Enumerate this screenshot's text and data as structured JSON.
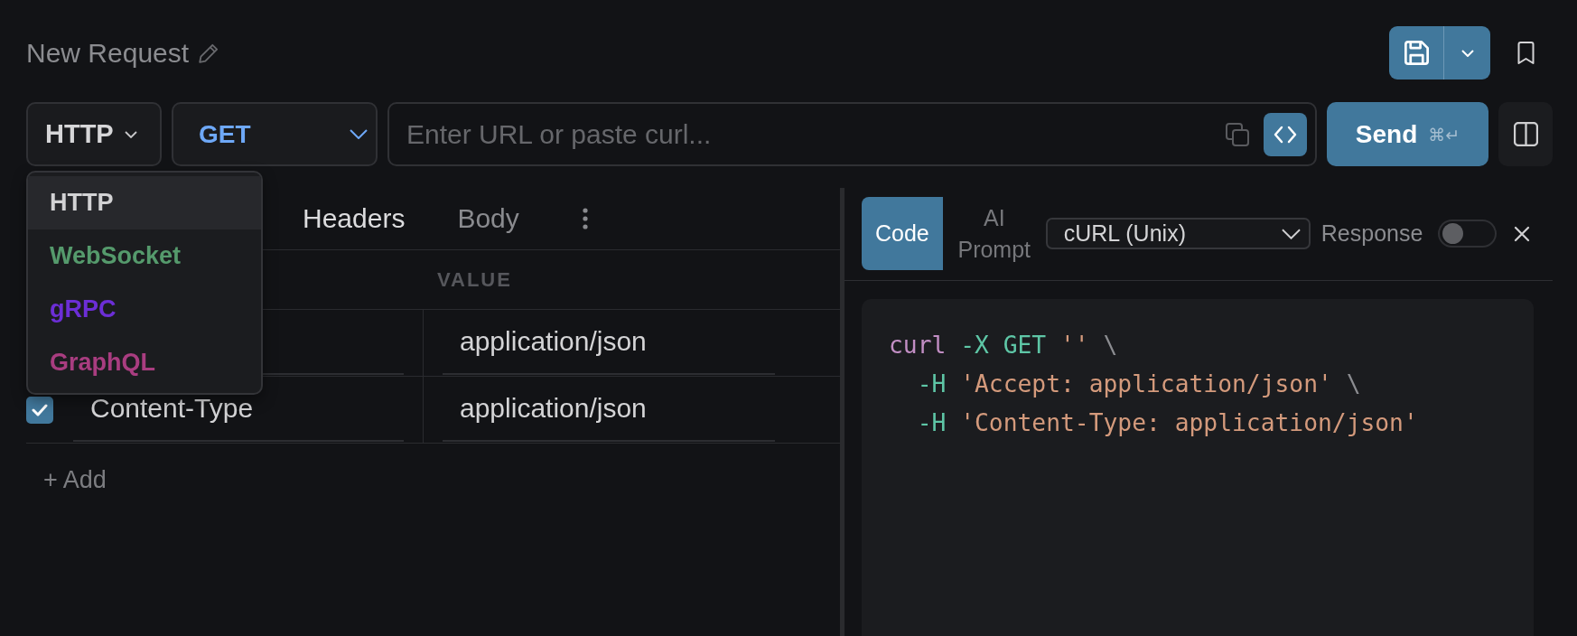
{
  "request": {
    "title": "New Request"
  },
  "toolbar": {
    "protocol": "HTTP",
    "method": "GET",
    "url": {
      "placeholder": "Enter URL or paste curl..."
    },
    "send": {
      "label": "Send",
      "shortcut": "⌘↵"
    }
  },
  "protocol_menu": {
    "items": [
      {
        "label": "HTTP",
        "selected": true,
        "color": "#d2d2d4"
      },
      {
        "label": "WebSocket",
        "selected": false,
        "color": "#559a6c"
      },
      {
        "label": "gRPC",
        "selected": false,
        "color": "#6c2ed6"
      },
      {
        "label": "GraphQL",
        "selected": false,
        "color": "#a93d80"
      }
    ]
  },
  "tabs": [
    {
      "label": "Headers",
      "selected": true
    },
    {
      "label": "Body",
      "selected": false
    }
  ],
  "headers_table": {
    "value_column": "VALUE",
    "rows": [
      {
        "value": "application/json"
      },
      {
        "checked": true,
        "name": "Content-Type",
        "value": "application/json"
      }
    ],
    "add": "+ Add"
  },
  "code_panel": {
    "tabs": [
      {
        "label": "Code",
        "selected": true
      },
      {
        "label": "AI Prompt",
        "selected": false
      }
    ],
    "language": "cURL (Unix)",
    "response_toggle": {
      "label": "Response",
      "on": false
    },
    "lines": [
      {
        "kind": "command",
        "tokens": [
          {
            "kind": "command",
            "text": "curl"
          },
          {
            "kind": "flag",
            "text": " -X GET"
          },
          {
            "kind": "string",
            "text": " ''"
          },
          {
            "kind": "plain",
            "text": " \\"
          }
        ]
      },
      {
        "kind": "continuation",
        "tokens": [
          {
            "kind": "flag",
            "text": "-H"
          },
          {
            "kind": "string",
            "text": " 'Accept: application/json'"
          },
          {
            "kind": "plain",
            "text": " \\"
          }
        ]
      },
      {
        "kind": "continuation",
        "tokens": [
          {
            "kind": "flag",
            "text": "-H"
          },
          {
            "kind": "string",
            "text": " 'Content-Type: application/json'"
          }
        ]
      }
    ]
  }
}
